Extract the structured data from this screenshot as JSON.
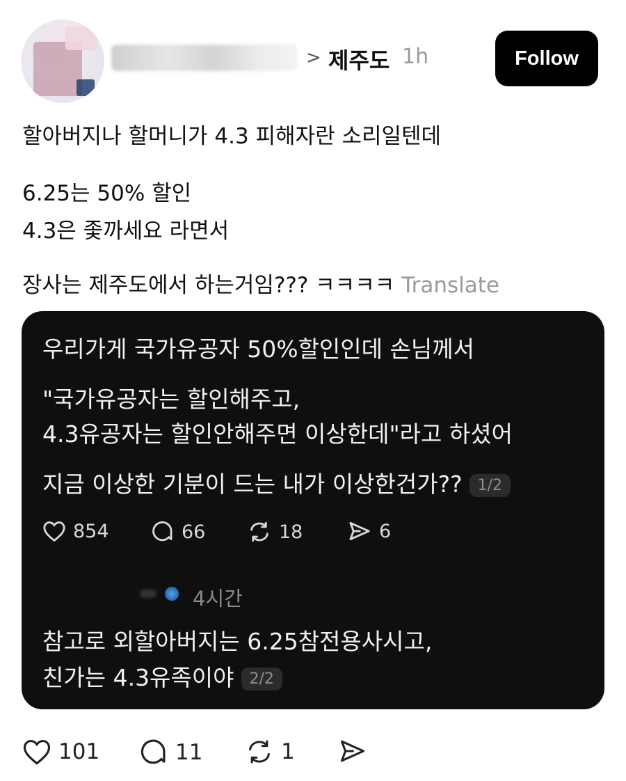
{
  "header": {
    "breadcrumb_separator": ">",
    "community": "제주도",
    "time": "1h",
    "follow_label": "Follow"
  },
  "post": {
    "lines": [
      "할아버지나 할머니가 4.3 피해자란 소리일텐데",
      "6.25는 50% 할인",
      "4.3은 좇까세요 라면서",
      "장사는 제주도에서 하는거임??? ㅋㅋㅋㅋ"
    ],
    "translate_label": "Translate"
  },
  "embedded": {
    "lines": [
      "우리가게 국가유공자 50%할인인데 손님께서",
      "\"국가유공자는 할인해주고,",
      "4.3유공자는 할인안해주면 이상한데\"라고 하셨어",
      "지금 이상한 기분이 드는 내가 이상한건가??"
    ],
    "page_1": "1/2",
    "actions": {
      "likes": "854",
      "replies": "66",
      "reposts": "18",
      "shares": "6"
    },
    "reply": {
      "time": "4시간",
      "lines": [
        "참고로 외할아버지는 6.25참전용사시고,",
        "친가는 4.3유족이야"
      ],
      "page_2": "2/2"
    }
  },
  "actions": {
    "likes": "101",
    "replies": "11",
    "reposts": "1"
  },
  "icons": [
    "heart-icon",
    "comment-icon",
    "repost-icon",
    "share-icon",
    "chevron-right-icon"
  ],
  "colors": {
    "follow_bg": "#000000",
    "card_bg": "#0f0f10",
    "muted_text": "#9a9a9a"
  }
}
